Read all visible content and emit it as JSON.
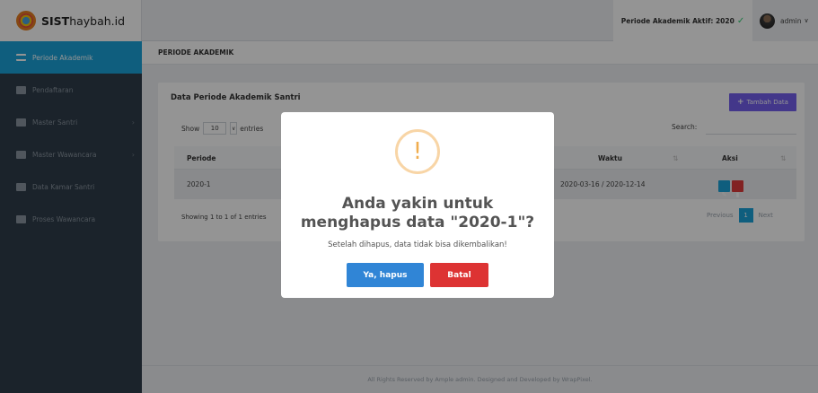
{
  "brand": {
    "bold": "SIST",
    "rest": "haybah.id"
  },
  "header": {
    "period_active": "Periode Akademik Aktif: 2020",
    "check_icon": "check-icon",
    "user": "admin",
    "user_caret": "∨"
  },
  "sidebar": {
    "items": [
      {
        "label": "Periode Akademik",
        "icon": "list-icon",
        "active": true
      },
      {
        "label": "Pendaftaran",
        "icon": "file-icon"
      },
      {
        "label": "Master Santri",
        "icon": "id-card-icon",
        "arrow": "›"
      },
      {
        "label": "Master Wawancara",
        "icon": "id-card-icon",
        "arrow": "›"
      },
      {
        "label": "Data Kamar Santri",
        "icon": "bed-icon"
      },
      {
        "label": "Proses Wawancara",
        "icon": "chat-icon"
      }
    ]
  },
  "page": {
    "title": "PERIODE AKADEMIK"
  },
  "card": {
    "title": "Data Periode Akademik Santri",
    "add_button": "Tambah Data",
    "show_label": "Show",
    "entries_value": "10",
    "entries_label": "entries",
    "search_label": "Search:",
    "columns": [
      "Periode",
      "Waktu",
      "Aksi"
    ],
    "sort_glyph": "⇅",
    "rows": [
      {
        "periode": "2020-1",
        "waktu": "2020-03-16 / 2020-12-14"
      }
    ],
    "showing": "Showing 1 to 1 of 1 entries",
    "pager": {
      "previous": "Previous",
      "page": "1",
      "next": "Next"
    }
  },
  "footer": {
    "text": "All Rights Reserved by Ample admin. Designed and Developed by WrapPixel."
  },
  "modal": {
    "icon": "!",
    "title_line1": "Anda yakin untuk",
    "title_line2": "menghapus data \"2020-1\"?",
    "text": "Setelah dihapus, data tidak bisa dikembalikan!",
    "confirm": "Ya, hapus",
    "cancel": "Batal"
  },
  "colors": {
    "sidebar": "#2f3d4a",
    "accent": "#1aa3d9",
    "add_button": "#7460ee",
    "confirm": "#3085d6",
    "cancel": "#dd3333",
    "warning": "#f0ad4e"
  }
}
